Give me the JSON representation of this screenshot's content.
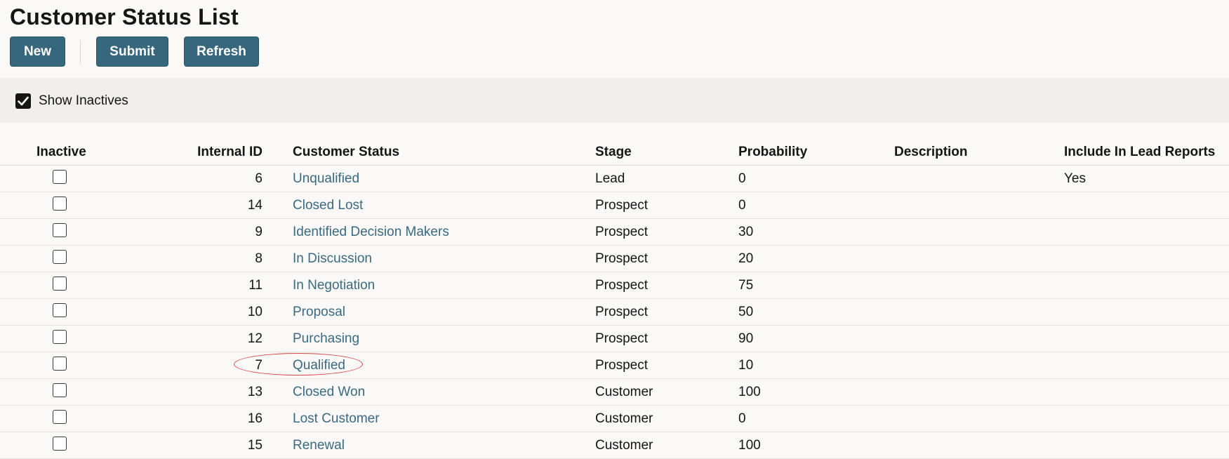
{
  "page": {
    "title": "Customer Status List"
  },
  "toolbar": {
    "new_label": "New",
    "submit_label": "Submit",
    "refresh_label": "Refresh"
  },
  "filters": {
    "show_inactives_label": "Show Inactives",
    "show_inactives_checked": true
  },
  "table": {
    "headers": {
      "inactive": "Inactive",
      "internal_id": "Internal ID",
      "customer_status": "Customer Status",
      "stage": "Stage",
      "probability": "Probability",
      "description": "Description",
      "include_in_lead_reports": "Include In Lead Reports"
    },
    "rows": [
      {
        "inactive": false,
        "id": "6",
        "status": "Unqualified",
        "stage": "Lead",
        "probability": "0",
        "description": "",
        "lead_reports": "Yes"
      },
      {
        "inactive": false,
        "id": "14",
        "status": "Closed Lost",
        "stage": "Prospect",
        "probability": "0",
        "description": "",
        "lead_reports": ""
      },
      {
        "inactive": false,
        "id": "9",
        "status": "Identified Decision Makers",
        "stage": "Prospect",
        "probability": "30",
        "description": "",
        "lead_reports": ""
      },
      {
        "inactive": false,
        "id": "8",
        "status": "In Discussion",
        "stage": "Prospect",
        "probability": "20",
        "description": "",
        "lead_reports": ""
      },
      {
        "inactive": false,
        "id": "11",
        "status": "In Negotiation",
        "stage": "Prospect",
        "probability": "75",
        "description": "",
        "lead_reports": ""
      },
      {
        "inactive": false,
        "id": "10",
        "status": "Proposal",
        "stage": "Prospect",
        "probability": "50",
        "description": "",
        "lead_reports": ""
      },
      {
        "inactive": false,
        "id": "12",
        "status": "Purchasing",
        "stage": "Prospect",
        "probability": "90",
        "description": "",
        "lead_reports": ""
      },
      {
        "inactive": false,
        "id": "7",
        "status": "Qualified",
        "stage": "Prospect",
        "probability": "10",
        "description": "",
        "lead_reports": ""
      },
      {
        "inactive": false,
        "id": "13",
        "status": "Closed Won",
        "stage": "Customer",
        "probability": "100",
        "description": "",
        "lead_reports": ""
      },
      {
        "inactive": false,
        "id": "16",
        "status": "Lost Customer",
        "stage": "Customer",
        "probability": "0",
        "description": "",
        "lead_reports": ""
      },
      {
        "inactive": false,
        "id": "15",
        "status": "Renewal",
        "stage": "Customer",
        "probability": "100",
        "description": "",
        "lead_reports": ""
      }
    ]
  },
  "colors": {
    "button_bg": "#36677d",
    "link": "#3a6a80",
    "highlight": "#d94444",
    "filter_bar_bg": "#f1efed"
  }
}
